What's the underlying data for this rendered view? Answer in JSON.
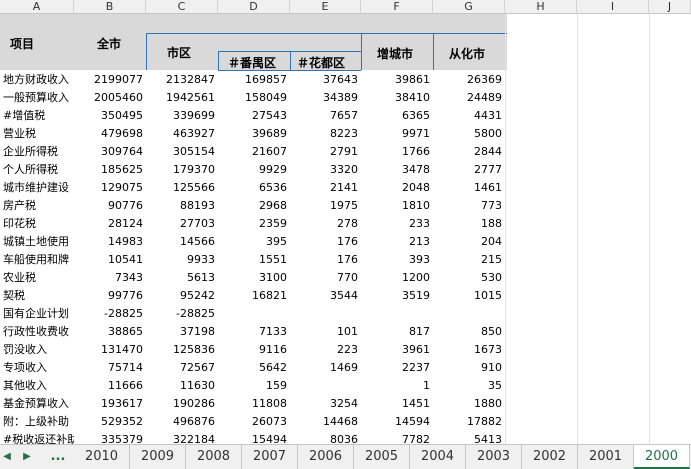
{
  "columns": [
    "A",
    "B",
    "C",
    "D",
    "E",
    "F",
    "G",
    "H",
    "I",
    "J"
  ],
  "header": {
    "item": "项目",
    "total": "全市",
    "city": "市区",
    "panyu": "＃番禺区",
    "huadu": "＃花都区",
    "zengcheng": "增城市",
    "conghua": "从化市"
  },
  "rows": [
    {
      "label": "地方财政收入",
      "b": "2199077",
      "c": "2132847",
      "d": "169857",
      "e": "37643",
      "f": "39861",
      "g": "26369"
    },
    {
      "label": "一般预算收入",
      "b": "2005460",
      "c": "1942561",
      "d": "158049",
      "e": "34389",
      "f": "38410",
      "g": "24489"
    },
    {
      "label": "#增值税",
      "b": "350495",
      "c": "339699",
      "d": "27543",
      "e": "7657",
      "f": "6365",
      "g": "4431"
    },
    {
      "label": "营业税",
      "b": "479698",
      "c": "463927",
      "d": "39689",
      "e": "8223",
      "f": "9971",
      "g": "5800"
    },
    {
      "label": "企业所得税",
      "b": "309764",
      "c": "305154",
      "d": "21607",
      "e": "2791",
      "f": "1766",
      "g": "2844"
    },
    {
      "label": "个人所得税",
      "b": "185625",
      "c": "179370",
      "d": "9929",
      "e": "3320",
      "f": "3478",
      "g": "2777"
    },
    {
      "label": "城市维护建设",
      "b": "129075",
      "c": "125566",
      "d": "6536",
      "e": "2141",
      "f": "2048",
      "g": "1461"
    },
    {
      "label": "房产税",
      "b": "90776",
      "c": "88193",
      "d": "2968",
      "e": "1975",
      "f": "1810",
      "g": "773"
    },
    {
      "label": "印花税",
      "b": "28124",
      "c": "27703",
      "d": "2359",
      "e": "278",
      "f": "233",
      "g": "188"
    },
    {
      "label": "城镇土地使用",
      "b": "14983",
      "c": "14566",
      "d": "395",
      "e": "176",
      "f": "213",
      "g": "204"
    },
    {
      "label": "车船使用和牌",
      "b": "10541",
      "c": "9933",
      "d": "1551",
      "e": "176",
      "f": "393",
      "g": "215"
    },
    {
      "label": "农业税",
      "b": "7343",
      "c": "5613",
      "d": "3100",
      "e": "770",
      "f": "1200",
      "g": "530"
    },
    {
      "label": "契税",
      "b": "99776",
      "c": "95242",
      "d": "16821",
      "e": "3544",
      "f": "3519",
      "g": "1015"
    },
    {
      "label": "国有企业计划",
      "b": "-28825",
      "c": "-28825",
      "d": "",
      "e": "",
      "f": "",
      "g": ""
    },
    {
      "label": "行政性收费收",
      "b": "38865",
      "c": "37198",
      "d": "7133",
      "e": "101",
      "f": "817",
      "g": "850"
    },
    {
      "label": "罚没收入",
      "b": "131470",
      "c": "125836",
      "d": "9116",
      "e": "223",
      "f": "3961",
      "g": "1673"
    },
    {
      "label": "专项收入",
      "b": "75714",
      "c": "72567",
      "d": "5642",
      "e": "1469",
      "f": "2237",
      "g": "910"
    },
    {
      "label": "其他收入",
      "b": "11666",
      "c": "11630",
      "d": "159",
      "e": "",
      "f": "1",
      "g": "35"
    },
    {
      "label": "基金预算收入",
      "b": "193617",
      "c": "190286",
      "d": "11808",
      "e": "3254",
      "f": "1451",
      "g": "1880"
    },
    {
      "label": "附：上级补助",
      "b": "529352",
      "c": "496876",
      "d": "26073",
      "e": "14468",
      "f": "14594",
      "g": "17882"
    },
    {
      "label": "#税收返还补助",
      "b": "335379",
      "c": "322184",
      "d": "15494",
      "e": "8036",
      "f": "7782",
      "g": "5413"
    }
  ],
  "tabs": {
    "nav_prev": "◀",
    "nav_next": "▶",
    "more": "...",
    "sheets": [
      "2010",
      "2009",
      "2008",
      "2007",
      "2006",
      "2005",
      "2004",
      "2003",
      "2002",
      "2001",
      "2000"
    ],
    "active": "2000"
  },
  "colors": {
    "accent": "#2e75b6",
    "header_fill": "#d9d9d9",
    "active_tab": "#217346"
  }
}
